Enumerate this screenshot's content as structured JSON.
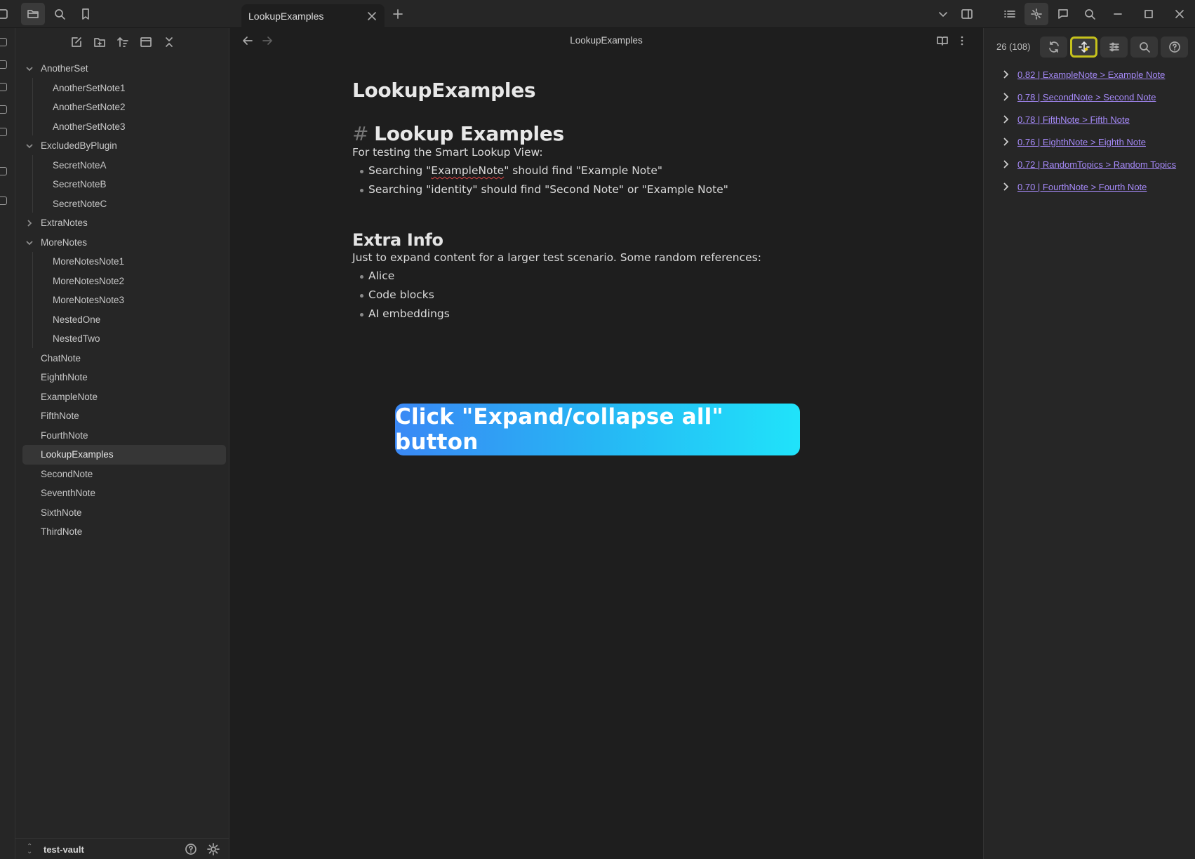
{
  "tab": {
    "title": "LookupExamples"
  },
  "editor": {
    "view_title": "LookupExamples",
    "note_title": "LookupExamples",
    "h1_hash": "#",
    "h1": "Lookup Examples",
    "intro": "For testing the Smart Lookup View:",
    "bullet1_pre": "Searching \"",
    "bullet1_word": "ExampleNote",
    "bullet1_post": "\" should find \"Example Note\"",
    "bullet2": "Searching \"identity\" should find \"Second Note\" or \"Example Note\"",
    "h2": "Extra Info",
    "para2": "Just to expand content for a larger test scenario. Some random references:",
    "refs": [
      "Alice",
      "Code blocks",
      "AI embeddings"
    ]
  },
  "callout": {
    "text": "Click \"Expand/collapse all\" button"
  },
  "sidebar": {
    "vault_name": "test-vault",
    "tree": [
      {
        "label": "AnotherSet",
        "kind": "folder",
        "open": true
      },
      {
        "label": "AnotherSetNote1",
        "kind": "child"
      },
      {
        "label": "AnotherSetNote2",
        "kind": "child"
      },
      {
        "label": "AnotherSetNote3",
        "kind": "child"
      },
      {
        "label": "ExcludedByPlugin",
        "kind": "folder",
        "open": true
      },
      {
        "label": "SecretNoteA",
        "kind": "child"
      },
      {
        "label": "SecretNoteB",
        "kind": "child"
      },
      {
        "label": "SecretNoteC",
        "kind": "child"
      },
      {
        "label": "ExtraNotes",
        "kind": "folder",
        "open": false
      },
      {
        "label": "MoreNotes",
        "kind": "folder",
        "open": true
      },
      {
        "label": "MoreNotesNote1",
        "kind": "child"
      },
      {
        "label": "MoreNotesNote2",
        "kind": "child"
      },
      {
        "label": "MoreNotesNote3",
        "kind": "child"
      },
      {
        "label": "NestedOne",
        "kind": "child"
      },
      {
        "label": "NestedTwo",
        "kind": "child"
      },
      {
        "label": "ChatNote",
        "kind": "file"
      },
      {
        "label": "EighthNote",
        "kind": "file"
      },
      {
        "label": "ExampleNote",
        "kind": "file"
      },
      {
        "label": "FifthNote",
        "kind": "file"
      },
      {
        "label": "FourthNote",
        "kind": "file"
      },
      {
        "label": "LookupExamples",
        "kind": "file",
        "selected": true
      },
      {
        "label": "SecondNote",
        "kind": "file"
      },
      {
        "label": "SeventhNote",
        "kind": "file"
      },
      {
        "label": "SixthNote",
        "kind": "file"
      },
      {
        "label": "ThirdNote",
        "kind": "file"
      }
    ]
  },
  "lookup": {
    "count": "26 (108)",
    "results": [
      "0.82 | ExampleNote > Example Note",
      "0.78 | SecondNote > Second Note",
      "0.78 | FifthNote > Fifth Note",
      "0.76 | EighthNote > Eighth Note",
      "0.72 | RandomTopics > Random Topics",
      "0.70 | FourthNote > Fourth Note"
    ]
  },
  "colors": {
    "link": "#a68af9",
    "highlight": "#c6c21c",
    "callout_start": "#3a88f5",
    "callout_end": "#20e3fa"
  }
}
